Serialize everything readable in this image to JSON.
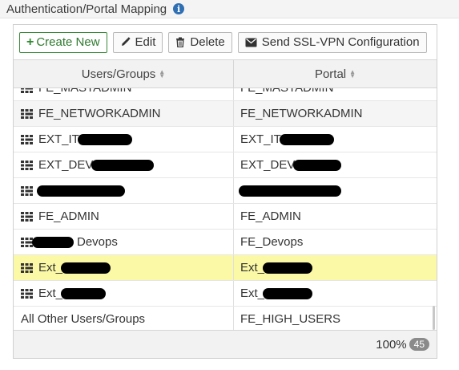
{
  "section": {
    "title": "Authentication/Portal Mapping",
    "info_icon": "info-icon"
  },
  "toolbar": {
    "create_new": "Create New",
    "edit": "Edit",
    "delete": "Delete",
    "send_ssl_vpn": "Send SSL-VPN Configuration"
  },
  "table": {
    "columns": [
      "Users/Groups",
      "Portal"
    ],
    "rows": [
      {
        "user": "FE_MASTADMIN",
        "portal": "FE_MASTADMIN",
        "icon": "group-icon",
        "redact_user": 0,
        "redact_portal": 0,
        "state": "partial"
      },
      {
        "user": "FE_NETWORKADMIN",
        "portal": "FE_NETWORKADMIN",
        "icon": "group-icon",
        "redact_user": 0,
        "redact_portal": 0,
        "state": "alt"
      },
      {
        "user": "EXT_IT",
        "portal": "EXT_IT",
        "icon": "group-icon",
        "redact_user": 68,
        "redact_portal": 68,
        "state": ""
      },
      {
        "user": "EXT_DEV",
        "portal": "EXT_DEV",
        "icon": "group-icon",
        "redact_user": 78,
        "redact_portal": 60,
        "state": ""
      },
      {
        "user": "",
        "portal": "",
        "icon": "group-icon",
        "redact_user": 110,
        "redact_portal": 128,
        "state": ""
      },
      {
        "user": "FE_ADMIN",
        "portal": "FE_ADMIN",
        "icon": "group-icon",
        "redact_user": 0,
        "redact_portal": 0,
        "state": ""
      },
      {
        "user": "Devops",
        "portal": "FE_Devops",
        "icon": "group-icon",
        "redact_user": 52,
        "redact_portal": 0,
        "state": ""
      },
      {
        "user": "Ext_",
        "portal": "Ext_",
        "icon": "group-icon",
        "redact_user": 62,
        "redact_portal": 62,
        "state": "selected"
      },
      {
        "user": "Ext_",
        "portal": "Ext_",
        "icon": "group-icon",
        "redact_user": 56,
        "redact_portal": 62,
        "state": ""
      },
      {
        "user": "All Other Users/Groups",
        "portal": "FE_HIGH_USERS",
        "icon": "",
        "redact_user": 0,
        "redact_portal": 0,
        "state": ""
      }
    ]
  },
  "footer": {
    "zoom": "100%",
    "count": "45"
  },
  "colors": {
    "accent": "#2f8a2f",
    "selected_row": "#fbf9a6",
    "info": "#2f6fb3"
  }
}
